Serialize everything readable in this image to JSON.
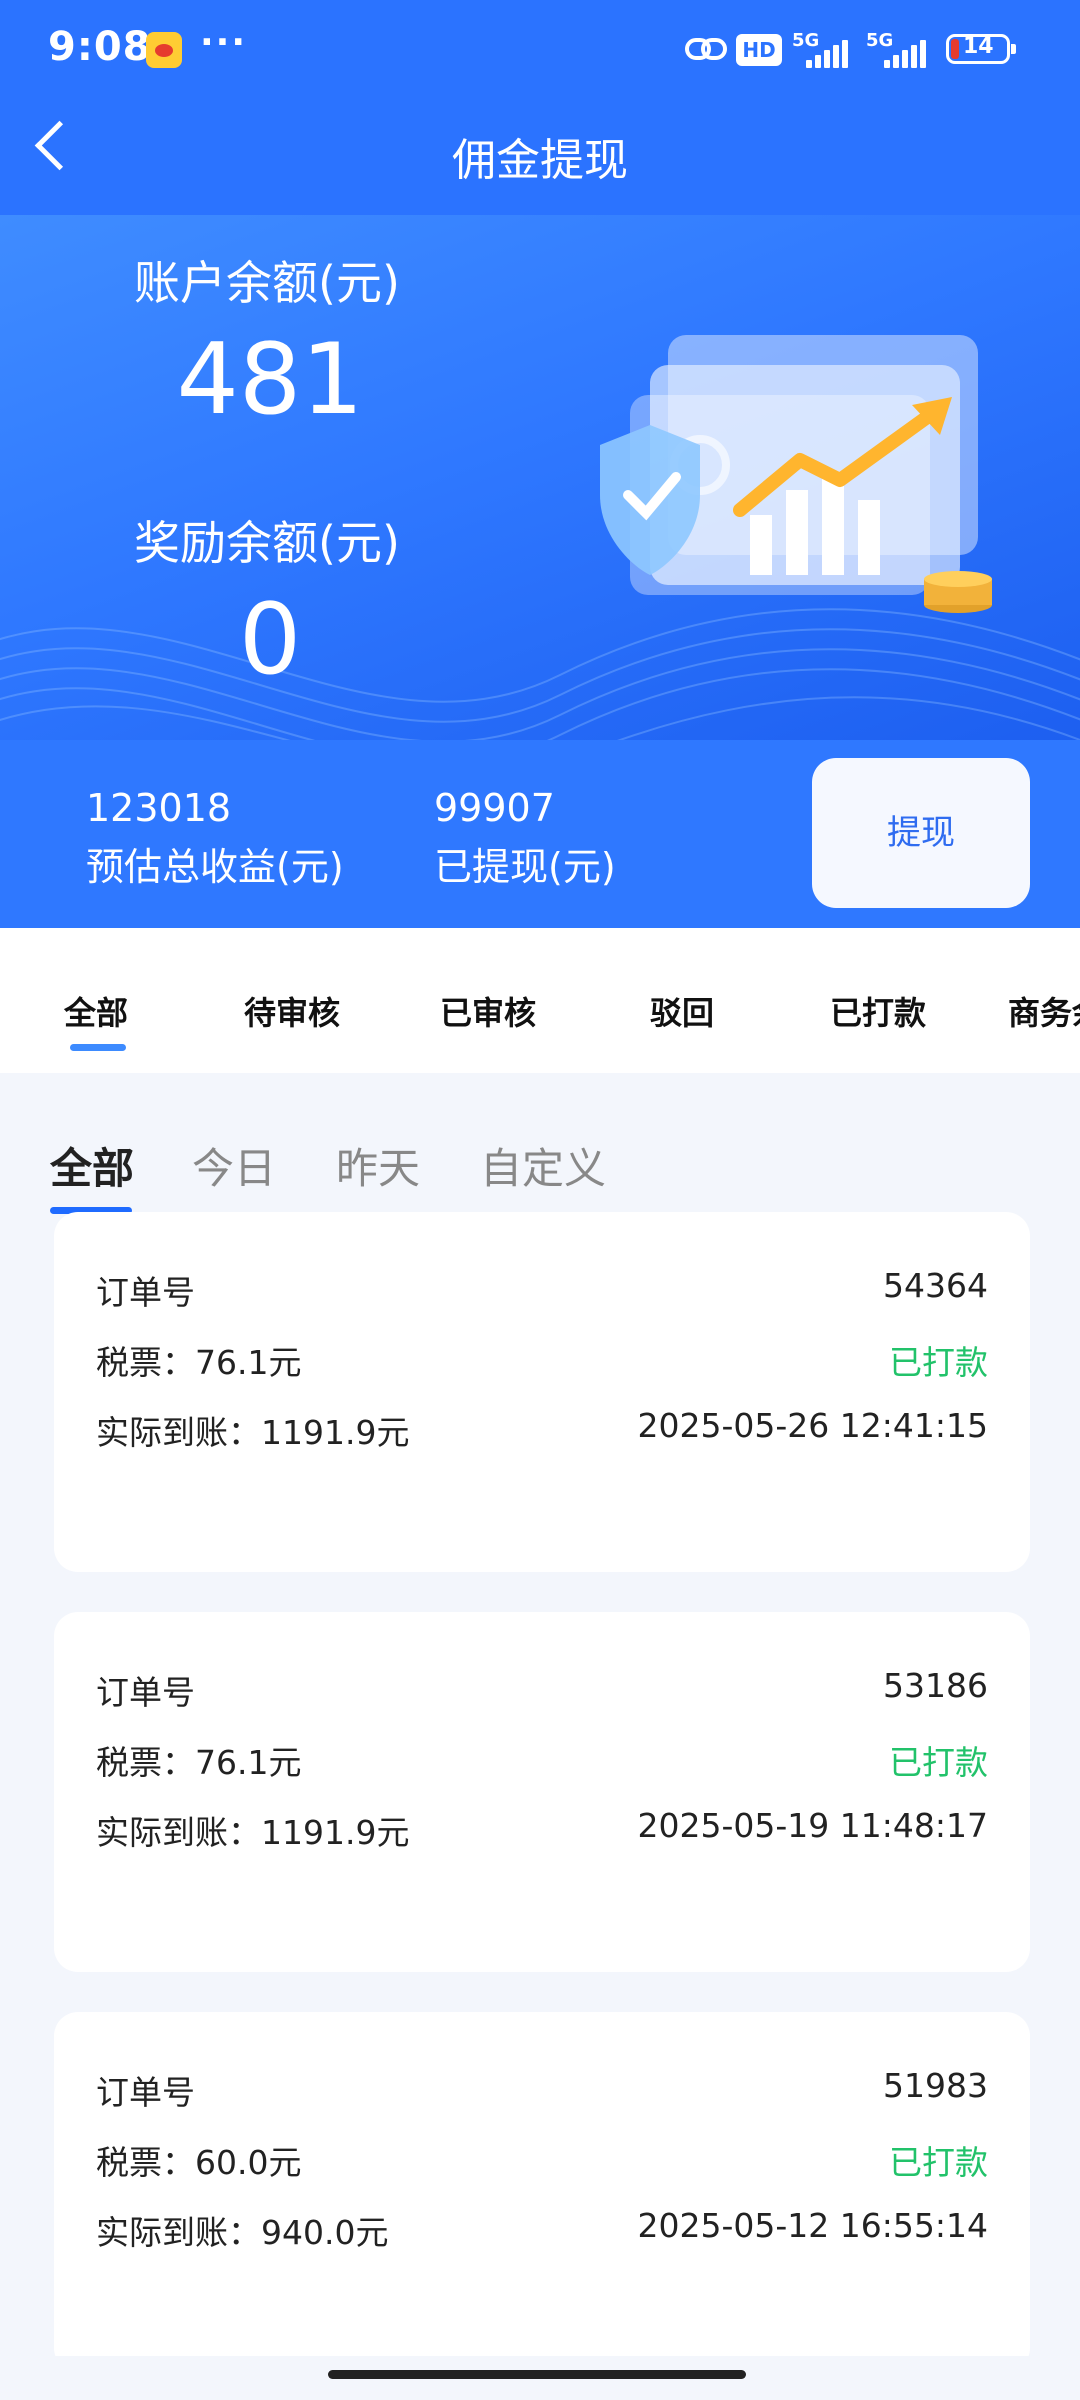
{
  "status_bar": {
    "time": "9:08",
    "hd": "HD",
    "sig1": "5G",
    "sig2": "5G",
    "battery": "14"
  },
  "header": {
    "title": "佣金提现"
  },
  "balance": {
    "account_label": "账户余额(元)",
    "account_value": "481",
    "reward_label": "奖励余额(元)",
    "reward_value": "0"
  },
  "summary": {
    "total_value": "123018",
    "total_label": "预估总收益(元)",
    "withdrawn_value": "99907",
    "withdrawn_label": "已提现(元)",
    "withdraw_button": "提现"
  },
  "tabs": [
    "全部",
    "待审核",
    "已审核",
    "驳回",
    "已打款",
    "商务余"
  ],
  "subtabs": [
    "全部",
    "今日",
    "昨天",
    "自定义"
  ],
  "orders": [
    {
      "order_label": "订单号",
      "order_no": "54364",
      "tax": "税票：76.1元",
      "status": "已打款",
      "actual": "实际到账：1191.9元",
      "time": "2025-05-26 12:41:15"
    },
    {
      "order_label": "订单号",
      "order_no": "53186",
      "tax": "税票：76.1元",
      "status": "已打款",
      "actual": "实际到账：1191.9元",
      "time": "2025-05-19 11:48:17"
    },
    {
      "order_label": "订单号",
      "order_no": "51983",
      "tax": "税票：60.0元",
      "status": "已打款",
      "actual": "实际到账：940.0元",
      "time": "2025-05-12 16:55:14"
    }
  ],
  "colors": {
    "primary": "#2b73ff",
    "status_paid": "#22c26a",
    "background": "#f3f6fc"
  }
}
